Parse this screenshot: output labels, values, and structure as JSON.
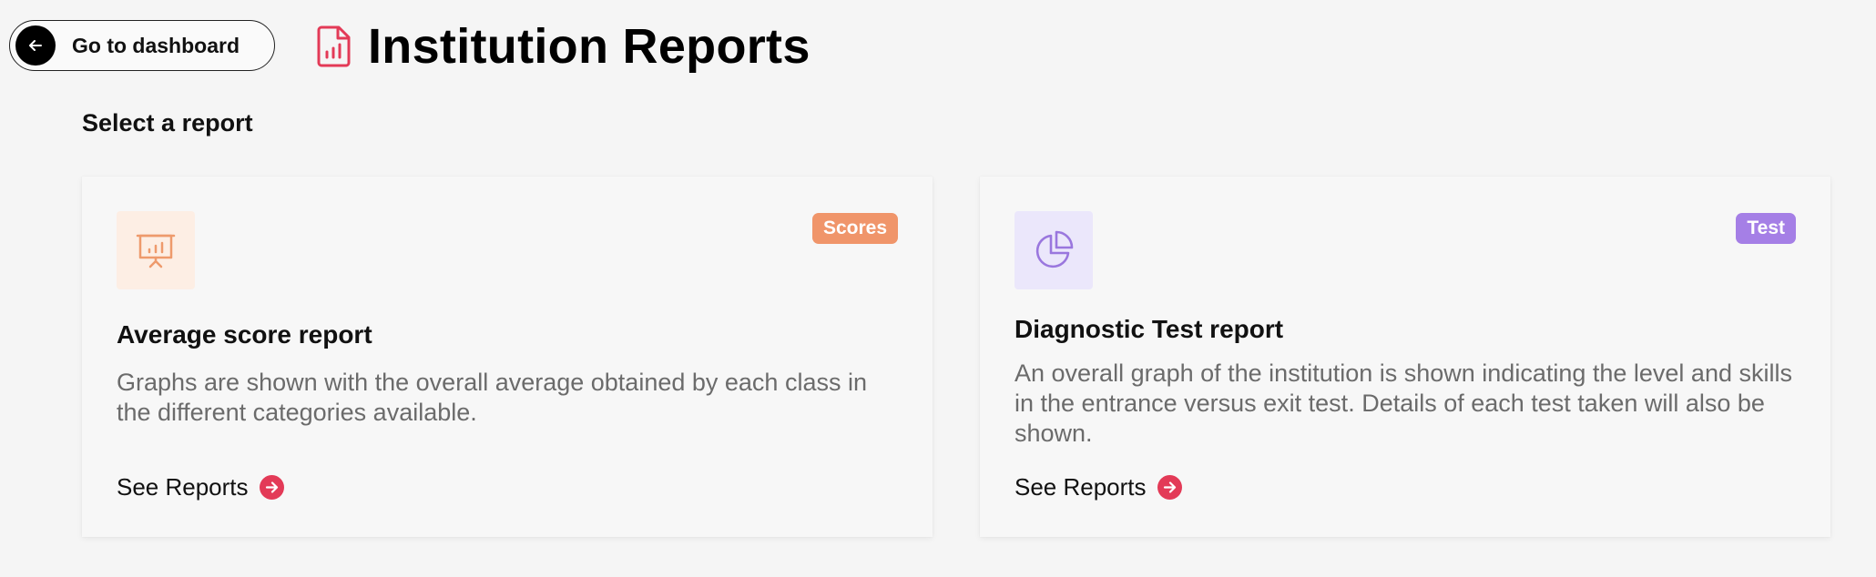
{
  "colors": {
    "accent_red": "#e33a57",
    "orange_badge": "#f0956a",
    "orange_icon_bg": "#fdeee4",
    "orange_icon": "#ee9a6c",
    "purple_badge": "#a57fe6",
    "purple_icon_bg": "#ebe7fb",
    "purple_icon": "#9a77de"
  },
  "header": {
    "back_label": "Go to dashboard",
    "back_icon": "arrow-left-icon",
    "title_icon": "report-file-icon",
    "title": "Institution Reports"
  },
  "section_label": "Select a report",
  "cards": [
    {
      "icon": "presentation-chart-icon",
      "badge": "Scores",
      "title": "Average score report",
      "description": "Graphs are shown with the overall average obtained by each class in the different categories available.",
      "link_label": "See Reports",
      "link_icon": "arrow-right-circle-icon"
    },
    {
      "icon": "pie-chart-icon",
      "badge": "Test",
      "title": "Diagnostic Test report",
      "description": "An overall graph of the institution is shown indicating the level and skills in the entrance versus exit test. Details of each test taken will also be shown.",
      "link_label": "See Reports",
      "link_icon": "arrow-right-circle-icon"
    }
  ]
}
